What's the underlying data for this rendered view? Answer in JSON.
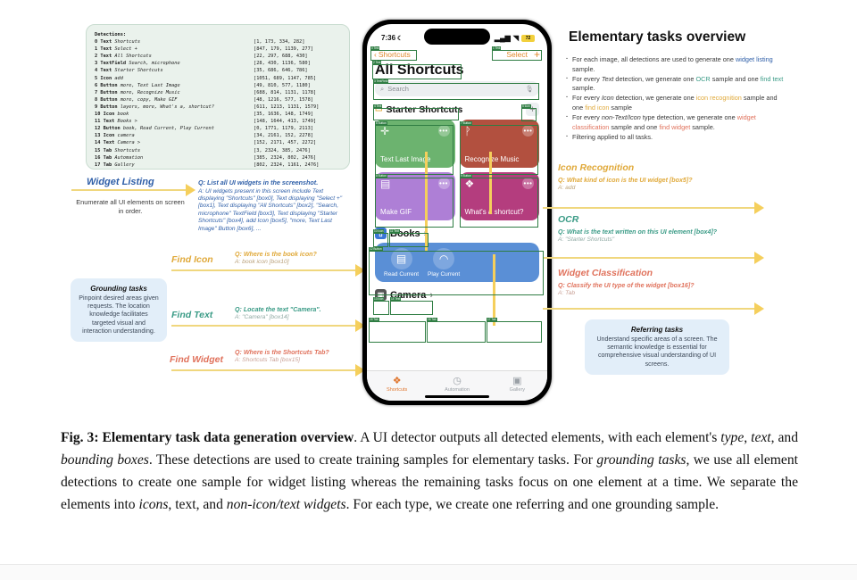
{
  "detections": {
    "title": "Detections:",
    "rows": [
      {
        "idx": "0",
        "type": "Text",
        "value": "Shortcuts",
        "box": "[1, 173, 334, 282]"
      },
      {
        "idx": "1",
        "type": "Text",
        "value": "Select +",
        "box": "[847, 179, 1139, 277]"
      },
      {
        "idx": "2",
        "type": "Text",
        "value": "All Shortcuts",
        "box": "[22, 297, 688, 430]"
      },
      {
        "idx": "3",
        "type": "TextField",
        "value": "Search, microphone",
        "box": "[28, 430, 1136, 580]"
      },
      {
        "idx": "4",
        "type": "Text",
        "value": "Starter Shortcuts",
        "box": "[35, 686, 646, 786]"
      },
      {
        "idx": "5",
        "type": "Icon",
        "value": "add",
        "box": "[1051, 689, 1147, 785]"
      },
      {
        "idx": "6",
        "type": "Button",
        "value": "more, Text Last Image",
        "box": "[49, 810, 577, 1180]"
      },
      {
        "idx": "7",
        "type": "Button",
        "value": "more, Recognize Music",
        "box": "[688, 814, 1131, 1178]"
      },
      {
        "idx": "8",
        "type": "Button",
        "value": "more, copy, Make GIF",
        "box": "[48, 1216, 577, 1578]"
      },
      {
        "idx": "9",
        "type": "Button",
        "value": "layers, more, What's a, shortcut?",
        "box": "[611, 1213, 1131, 1579]"
      },
      {
        "idx": "10",
        "type": "Icon",
        "value": "book",
        "box": "[35, 1636, 148, 1749]"
      },
      {
        "idx": "11",
        "type": "Text",
        "value": "Books >",
        "box": "[148, 1644, 413, 1749]"
      },
      {
        "idx": "12",
        "type": "Button",
        "value": "book, Read Current, Play Current",
        "box": "[0, 1771, 1179, 2113]"
      },
      {
        "idx": "13",
        "type": "Icon",
        "value": "camera",
        "box": "[34, 2161, 152, 2278]"
      },
      {
        "idx": "14",
        "type": "Text",
        "value": "Camera >",
        "box": "[152, 2171, 457, 2272]"
      },
      {
        "idx": "15",
        "type": "Tab",
        "value": "Shortcuts",
        "box": "[3, 2324, 385, 2476]"
      },
      {
        "idx": "16",
        "type": "Tab",
        "value": "Automation",
        "box": "[385, 2324, 802, 2476]"
      },
      {
        "idx": "17",
        "type": "Tab",
        "value": "Gallery",
        "box": "[802, 2324, 1161, 2476]"
      }
    ]
  },
  "tasks": {
    "widget_listing": {
      "label": "Widget Listing",
      "desc": "Enumerate all UI elements on screen in order.",
      "q": "Q: List all UI widgets in the screenshot.",
      "a": "A: UI widgets present in this screen include Text displaying \"Shortcuts\" [box0], Text displaying \"Select +\" [box1], Text displaying \"All Shortcuts\" [box2], \"Search, microphone\" TextField [box3], Text displaying \"Starter Shortcuts\" [box4], add Icon [box5], \"more, Text Last Image\" Button [box6], ...",
      "color": "#2f5fa8"
    },
    "find_icon": {
      "label": "Find Icon",
      "q": "Q: Where is the book icon?",
      "a": "A: book icon [box10]",
      "color": "#e0a93a"
    },
    "find_text": {
      "label": "Find Text",
      "q": "Q: Locate the text \"Camera\".",
      "a": "A: \"Camera\" [box14]",
      "color": "#3a9b86"
    },
    "find_widget": {
      "label": "Find Widget",
      "q": "Q: Where is the Shortcuts Tab?",
      "a": "A: Shortcuts Tab [box15]",
      "color": "#e0725c"
    },
    "icon_recognition": {
      "label": "Icon Recognition",
      "q": "Q: What kind of icon is the UI widget [box5]?",
      "a": "A: add",
      "color": "#e0a93a"
    },
    "ocr": {
      "label": "OCR",
      "q": "Q: What is the text written on this UI element [box4]?",
      "a": "A: \"Starter Shortcuts\"",
      "color": "#3a9b86"
    },
    "widget_classification": {
      "label": "Widget Classification",
      "q": "Q: Classify the UI type of the widget [box16]?",
      "a": "A: Tab",
      "color": "#e0725c"
    }
  },
  "cards": {
    "grounding": {
      "heading": "Grounding tasks",
      "body": "Pinpoint desired areas given requests. The location knowledge facilitates targeted visual and interaction understanding."
    },
    "referring": {
      "heading": "Referring tasks",
      "body": "Understand specific areas of a screen. The semantic knowledge is essential for comprehensive visual understanding of UI screens."
    }
  },
  "overview": {
    "title": "Elementary tasks overview",
    "bullets": [
      "For each image, all detections are used to generate one widget listing sample.",
      "For every Text detection, we generate one OCR sample and one find text sample.",
      "For every Icon detection, we generate one icon recognition sample and one find icon sample",
      "For every non-Text/Icon type detection, we generate one widget classification sample and one find widget sample.",
      "Filtering applied to all tasks."
    ]
  },
  "phone": {
    "status": {
      "time": "7:36",
      "moon_icon": "moon-icon",
      "signal_icon": "signal-icon",
      "wifi_icon": "wifi-icon",
      "battery": "72"
    },
    "nav": {
      "back": "Shortcuts",
      "select": "Select",
      "add": "+"
    },
    "title": "All Shortcuts",
    "search": {
      "placeholder": "Search",
      "search_icon": "search-icon",
      "mic_icon": "microphone-icon"
    },
    "folder": {
      "name": "Starter Shortcuts",
      "icon": "folder-icon",
      "add": "+"
    },
    "shortcut_cards": [
      {
        "label": "Text Last Image",
        "icon": "message-plus-icon",
        "color": "#6cb36f",
        "more": "•••"
      },
      {
        "label": "Recognize Music",
        "icon": "waveform-icon",
        "color": "#b2503f",
        "more": "•••"
      },
      {
        "label": "Make GIF",
        "icon": "photos-icon",
        "color": "#ae7fd6",
        "more": "•••"
      },
      {
        "label": "What's a shortcut?",
        "icon": "layers-icon",
        "color": "#b43d7e",
        "more": "•••"
      }
    ],
    "books": {
      "label": "Books",
      "chevron": "›",
      "icon": "book-icon",
      "actions": [
        {
          "label": "Read Current",
          "icon": "open-book-icon"
        },
        {
          "label": "Play Current",
          "icon": "headphones-icon"
        }
      ]
    },
    "camera": {
      "label": "Camera",
      "chevron": "›",
      "icon": "camera-icon"
    },
    "tabs": [
      {
        "label": "Shortcuts",
        "icon": "shortcuts-icon",
        "active": true
      },
      {
        "label": "Automation",
        "icon": "automation-icon",
        "active": false
      },
      {
        "label": "Gallery",
        "icon": "gallery-icon",
        "active": false
      }
    ]
  },
  "caption": {
    "prefix": "Fig. 3: Elementary task data generation overview",
    "body": ". A UI detector outputs all detected elements, with each element's type, text, and bounding boxes. These detections are used to create training samples for elementary tasks. For grounding tasks, we use all element detections to create one sample for widget listing whereas the remaining tasks focus on one element at a time. We separate the elements into icons, text, and non-icon/text widgets. For each type, we create one referring and one grounding sample."
  },
  "colors": {
    "yellow": "#f5cf5c",
    "green_box": "#2f7d43",
    "orange": "#e0762e",
    "blue_panel": "#5a8fd6"
  }
}
